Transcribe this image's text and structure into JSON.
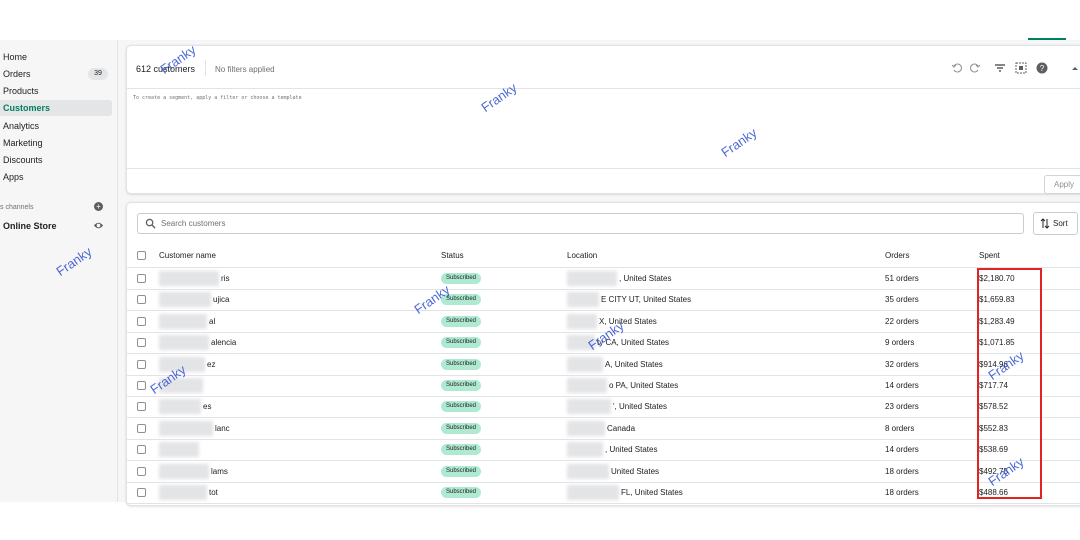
{
  "sidebar": {
    "items": [
      {
        "label": "Home"
      },
      {
        "label": "Orders",
        "badge": "39"
      },
      {
        "label": "Products"
      },
      {
        "label": "Customers",
        "active": true
      },
      {
        "label": "Analytics"
      },
      {
        "label": "Marketing"
      },
      {
        "label": "Discounts"
      },
      {
        "label": "Apps"
      }
    ],
    "sales_channels_label": "s channels",
    "online_store": "Online Store"
  },
  "segment": {
    "count_label": "612 customers",
    "filter_status": "No filters applied",
    "hint": "To create a segment, apply a filter or choose a template",
    "apply_label": "Apply"
  },
  "search": {
    "placeholder": "Search customers"
  },
  "sort_label": "Sort",
  "table": {
    "headers": {
      "name": "Customer name",
      "status": "Status",
      "location": "Location",
      "orders": "Orders",
      "spent": "Spent"
    },
    "rows": [
      {
        "name": "ris",
        "status": "Subscribed",
        "location": ", United States",
        "orders": "51 orders",
        "spent": "$2,180.70"
      },
      {
        "name": "ujica",
        "status": "Subscribed",
        "location": "E CITY UT, United States",
        "orders": "35 orders",
        "spent": "$1,659.83"
      },
      {
        "name": "al",
        "status": "Subscribed",
        "location": "X, United States",
        "orders": "22 orders",
        "spent": "$1,283.49"
      },
      {
        "name": "alencia",
        "status": "Subscribed",
        "location": "ty CA, United States",
        "orders": "9 orders",
        "spent": "$1,071.85"
      },
      {
        "name": "ez",
        "status": "Subscribed",
        "location": "A, United States",
        "orders": "32 orders",
        "spent": "$914.96"
      },
      {
        "name": "",
        "status": "Subscribed",
        "location": "o PA, United States",
        "orders": "14 orders",
        "spent": "$717.74"
      },
      {
        "name": "es",
        "status": "Subscribed",
        "location": "', United States",
        "orders": "23 orders",
        "spent": "$578.52"
      },
      {
        "name": "lanc",
        "status": "Subscribed",
        "location": "Canada",
        "orders": "8 orders",
        "spent": "$552.83"
      },
      {
        "name": "",
        "status": "Subscribed",
        "location": ", United States",
        "orders": "14 orders",
        "spent": "$538.69"
      },
      {
        "name": "lams",
        "status": "Subscribed",
        "location": "United States",
        "orders": "18 orders",
        "spent": "$492.75"
      },
      {
        "name": "tot",
        "status": "Subscribed",
        "location": "FL, United States",
        "orders": "18 orders",
        "spent": "$488.66"
      }
    ]
  },
  "watermark": "Franky",
  "colors": {
    "accent": "#008060",
    "badge_bg": "#aee9d1",
    "highlight": "#e02424",
    "watermark": "#2d4fd0"
  }
}
